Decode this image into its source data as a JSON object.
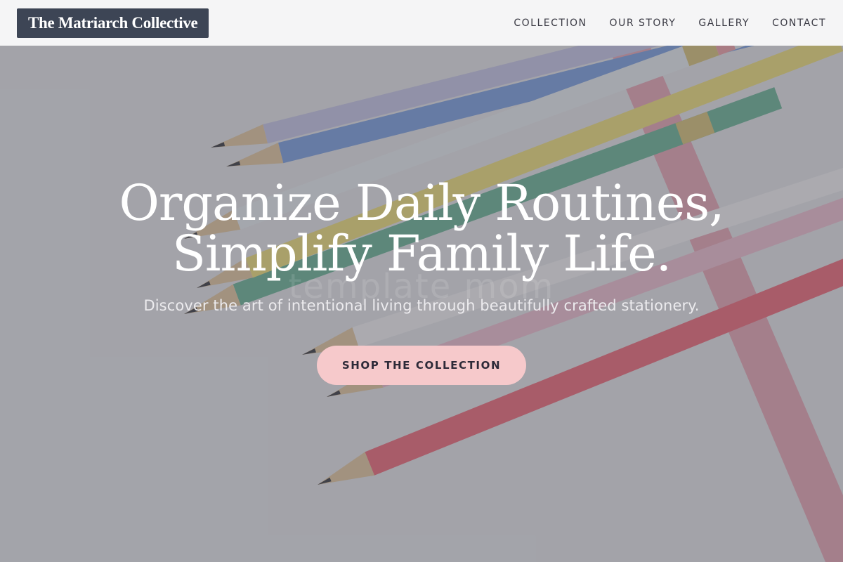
{
  "header": {
    "logo_text": "The Matriarch Collective",
    "nav": [
      {
        "label": "COLLECTION"
      },
      {
        "label": "OUR STORY"
      },
      {
        "label": "GALLERY"
      },
      {
        "label": "CONTACT"
      }
    ]
  },
  "hero": {
    "title_line1": "Organize Daily Routines,",
    "title_line2": "Simplify Family Life.",
    "watermark": "template mom",
    "subtitle": "Discover the art of intentional living through beautifully crafted stationery.",
    "cta_label": "SHOP THE COLLECTION",
    "background_image": "colored pencils on white desk with pink ribbon",
    "colors": {
      "cta_background": "#f6c9cb",
      "logo_background": "#3d4555",
      "header_background": "#f5f5f6"
    }
  }
}
